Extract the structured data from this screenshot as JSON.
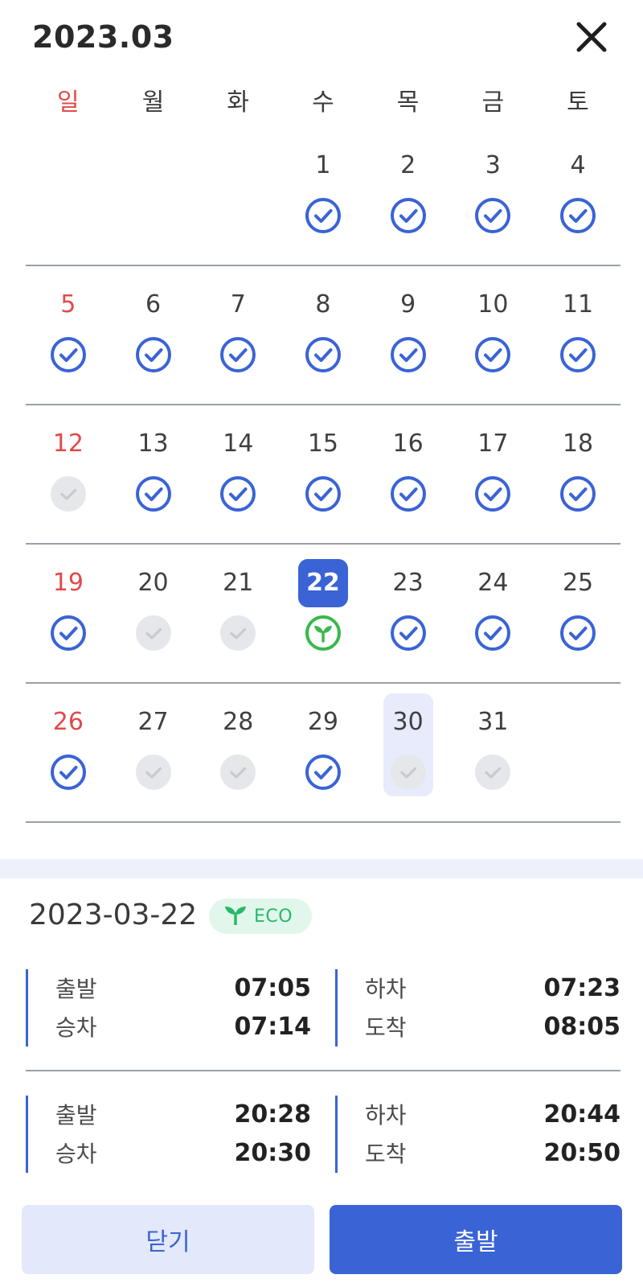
{
  "header": {
    "title": "2023.03"
  },
  "weekdays": [
    "일",
    "월",
    "화",
    "수",
    "목",
    "금",
    "토"
  ],
  "days": {
    "d1": {
      "n": "1",
      "s": "check"
    },
    "d2": {
      "n": "2",
      "s": "check"
    },
    "d3": {
      "n": "3",
      "s": "check"
    },
    "d4": {
      "n": "4",
      "s": "check"
    },
    "d5": {
      "n": "5",
      "s": "check"
    },
    "d6": {
      "n": "6",
      "s": "check"
    },
    "d7": {
      "n": "7",
      "s": "check"
    },
    "d8": {
      "n": "8",
      "s": "check"
    },
    "d9": {
      "n": "9",
      "s": "check"
    },
    "d10": {
      "n": "10",
      "s": "check"
    },
    "d11": {
      "n": "11",
      "s": "check"
    },
    "d12": {
      "n": "12",
      "s": "inactive"
    },
    "d13": {
      "n": "13",
      "s": "check"
    },
    "d14": {
      "n": "14",
      "s": "check"
    },
    "d15": {
      "n": "15",
      "s": "check"
    },
    "d16": {
      "n": "16",
      "s": "check"
    },
    "d17": {
      "n": "17",
      "s": "check"
    },
    "d18": {
      "n": "18",
      "s": "check"
    },
    "d19": {
      "n": "19",
      "s": "check"
    },
    "d20": {
      "n": "20",
      "s": "inactive"
    },
    "d21": {
      "n": "21",
      "s": "inactive"
    },
    "d22": {
      "n": "22",
      "s": "eco"
    },
    "d23": {
      "n": "23",
      "s": "check"
    },
    "d24": {
      "n": "24",
      "s": "check"
    },
    "d25": {
      "n": "25",
      "s": "check"
    },
    "d26": {
      "n": "26",
      "s": "check"
    },
    "d27": {
      "n": "27",
      "s": "inactive"
    },
    "d28": {
      "n": "28",
      "s": "inactive"
    },
    "d29": {
      "n": "29",
      "s": "check"
    },
    "d30": {
      "n": "30",
      "s": "inactive"
    },
    "d31": {
      "n": "31",
      "s": "inactive"
    }
  },
  "selected_day": "22",
  "highlighted_day": "30",
  "detail": {
    "date": "2023-03-22",
    "badge": "ECO",
    "trips": [
      {
        "depart_label": "출발",
        "depart_time": "07:05",
        "board_label": "승차",
        "board_time": "07:14",
        "alight_label": "하차",
        "alight_time": "07:23",
        "arrive_label": "도착",
        "arrive_time": "08:05"
      },
      {
        "depart_label": "출발",
        "depart_time": "20:28",
        "board_label": "승차",
        "board_time": "20:30",
        "alight_label": "하차",
        "alight_time": "20:44",
        "arrive_label": "도착",
        "arrive_time": "20:50"
      }
    ]
  },
  "buttons": {
    "close": "닫기",
    "depart": "출발"
  },
  "colors": {
    "accent": "#3a63d6",
    "sunday": "#e24a4a",
    "eco": "#3ab84a",
    "inactive": "#e6e7ea"
  }
}
